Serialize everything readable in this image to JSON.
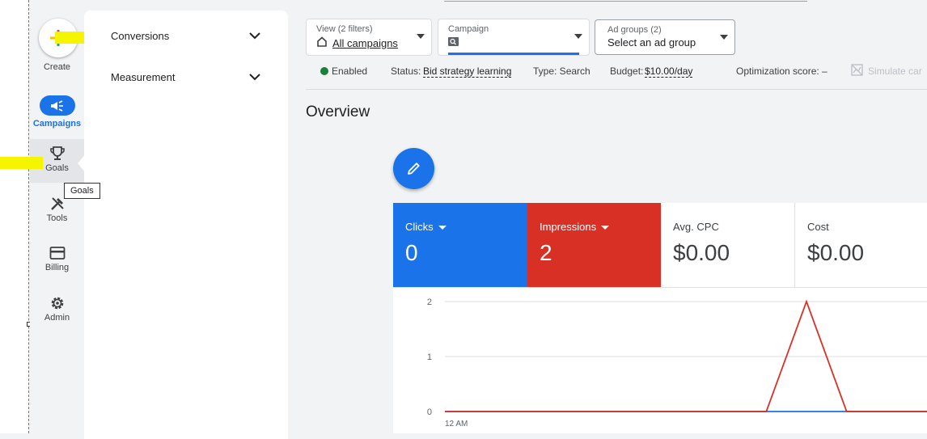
{
  "rail": {
    "create": "Create",
    "campaigns": "Campaigns",
    "goals": "Goals",
    "tools": "Tools",
    "billing": "Billing",
    "admin": "Admin"
  },
  "tooltip": "Goals",
  "panel": {
    "items": [
      {
        "label": "Conversions"
      },
      {
        "label": "Measurement"
      }
    ]
  },
  "filters": {
    "view": {
      "label": "View (2 filters)",
      "value": "All campaigns"
    },
    "campaign": {
      "label": "Campaign"
    },
    "ad_groups": {
      "label": "Ad groups (2)",
      "value": "Select an ad group"
    }
  },
  "status": {
    "enabled": "Enabled",
    "status_label": "Status:",
    "status_value": "Bid strategy learning",
    "type": "Type: Search",
    "budget_label": "Budget:",
    "budget_value": "$10.00/day",
    "optimization": "Optimization score: –",
    "simulate": "Simulate car"
  },
  "overview": {
    "title": "Overview"
  },
  "metrics": [
    {
      "name": "Clicks",
      "value": "0"
    },
    {
      "name": "Impressions",
      "value": "2"
    },
    {
      "name": "Avg. CPC",
      "value": "$0.00"
    },
    {
      "name": "Cost",
      "value": "$0.00"
    }
  ],
  "colors": {
    "blue": "#1a73e8",
    "red": "#d93025",
    "highlight": "#f5f500"
  },
  "chart_data": {
    "type": "line",
    "ylim": [
      0,
      2
    ],
    "y_ticks": [
      "0",
      "1",
      "2"
    ],
    "x_tick_labels": [
      "12 AM"
    ],
    "x": [
      0,
      1,
      2,
      3,
      4,
      5,
      6,
      7,
      8,
      9,
      10,
      11,
      12
    ],
    "series": [
      {
        "name": "Clicks",
        "color": "#1a73e8",
        "values": [
          0,
          0,
          0,
          0,
          0,
          0,
          0,
          0,
          0,
          0,
          0,
          0,
          0
        ]
      },
      {
        "name": "Impressions",
        "color": "#d93025",
        "values": [
          0,
          0,
          0,
          0,
          0,
          0,
          0,
          0,
          0,
          2,
          0,
          0,
          0
        ]
      }
    ]
  }
}
